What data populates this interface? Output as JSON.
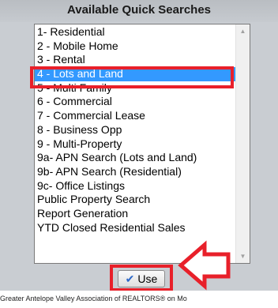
{
  "header": {
    "title": "Available Quick Searches"
  },
  "list": {
    "items": [
      "1- Residential",
      "2 - Mobile Home",
      "3 - Rental",
      "4 - Lots and Land",
      "5 - Multi Family",
      "6 - Commercial",
      "7 - Commercial Lease",
      "8 - Business Opp",
      "9 - Multi-Property",
      "9a- APN Search (Lots and Land)",
      "9b- APN Search (Residential)",
      "9c- Office Listings",
      "Public Property Search",
      "Report Generation",
      "YTD Closed Residential Sales"
    ],
    "selected_index": 3
  },
  "use_button": {
    "label": "Use",
    "icon": "checkmark-icon"
  },
  "footer": {
    "text": "Greater Antelope Valley Association of REALTORS® on Mo"
  },
  "colors": {
    "highlight": "#e8202a",
    "selection": "#3399ff",
    "panel": "#c9cdd2"
  }
}
